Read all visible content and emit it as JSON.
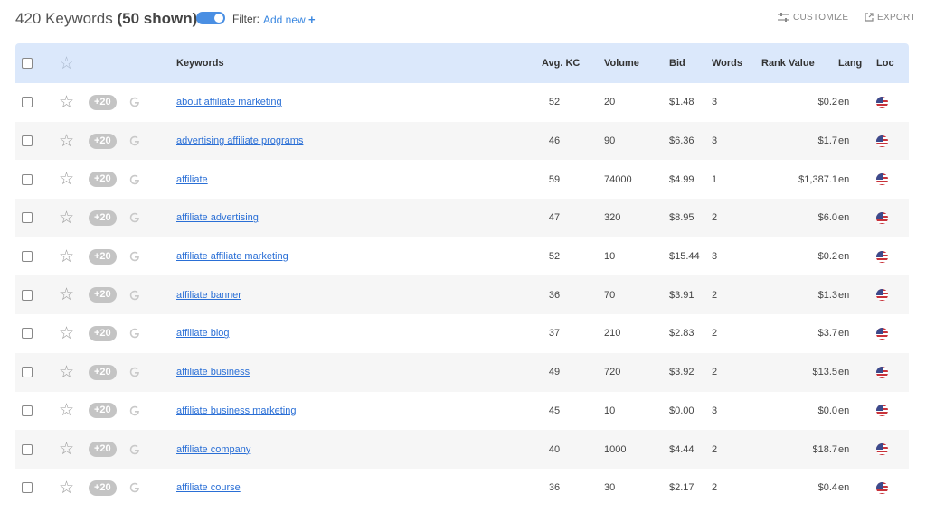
{
  "header": {
    "count_label": "420 Keywords",
    "shown_label": "(50 shown)",
    "filter_label": "Filter:",
    "add_new_label": "Add new",
    "add_new_icon": "+",
    "customize_label": "CUSTOMIZE",
    "export_label": "EXPORT",
    "toggle_on": true,
    "accent_color": "#4a8fe3"
  },
  "table": {
    "columns": {
      "keywords": "Keywords",
      "avg_kc": "Avg. KC",
      "volume": "Volume",
      "bid": "Bid",
      "words": "Words",
      "rank_value": "Rank Value",
      "lang": "Lang",
      "loc": "Loc"
    },
    "badge_label": "+20",
    "google_icon_label": "G",
    "star_icon": "☆",
    "rows": [
      {
        "keyword": "about affiliate marketing",
        "kc": "52",
        "volume": "20",
        "bid": "$1.48",
        "words": "3",
        "rank_value": "$0.2",
        "lang": "en"
      },
      {
        "keyword": "advertising affiliate programs",
        "kc": "46",
        "volume": "90",
        "bid": "$6.36",
        "words": "3",
        "rank_value": "$1.7",
        "lang": "en"
      },
      {
        "keyword": "affiliate",
        "kc": "59",
        "volume": "74000",
        "bid": "$4.99",
        "words": "1",
        "rank_value": "$1,387.1",
        "lang": "en"
      },
      {
        "keyword": "affiliate advertising",
        "kc": "47",
        "volume": "320",
        "bid": "$8.95",
        "words": "2",
        "rank_value": "$6.0",
        "lang": "en"
      },
      {
        "keyword": "affiliate affiliate marketing",
        "kc": "52",
        "volume": "10",
        "bid": "$15.44",
        "words": "3",
        "rank_value": "$0.2",
        "lang": "en"
      },
      {
        "keyword": "affiliate banner",
        "kc": "36",
        "volume": "70",
        "bid": "$3.91",
        "words": "2",
        "rank_value": "$1.3",
        "lang": "en"
      },
      {
        "keyword": "affiliate blog",
        "kc": "37",
        "volume": "210",
        "bid": "$2.83",
        "words": "2",
        "rank_value": "$3.7",
        "lang": "en"
      },
      {
        "keyword": "affiliate business",
        "kc": "49",
        "volume": "720",
        "bid": "$3.92",
        "words": "2",
        "rank_value": "$13.5",
        "lang": "en"
      },
      {
        "keyword": "affiliate business marketing",
        "kc": "45",
        "volume": "10",
        "bid": "$0.00",
        "words": "3",
        "rank_value": "$0.0",
        "lang": "en"
      },
      {
        "keyword": "affiliate company",
        "kc": "40",
        "volume": "1000",
        "bid": "$4.44",
        "words": "2",
        "rank_value": "$18.7",
        "lang": "en"
      },
      {
        "keyword": "affiliate course",
        "kc": "36",
        "volume": "30",
        "bid": "$2.17",
        "words": "2",
        "rank_value": "$0.4",
        "lang": "en"
      }
    ]
  }
}
